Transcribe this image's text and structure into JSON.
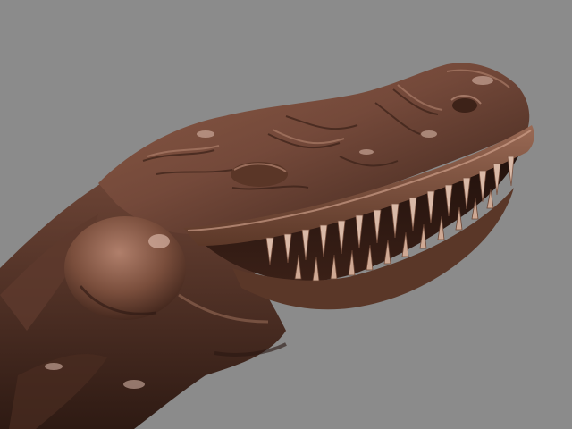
{
  "scene": {
    "subject_icon": "sculpted-dinosaur-head-icon",
    "background_color": "#8b8b8b",
    "material_color": "#7a4e3a",
    "highlight_color": "#c79a86",
    "shadow_color": "#2a1712",
    "tooth_color": "#d9b9a7"
  }
}
